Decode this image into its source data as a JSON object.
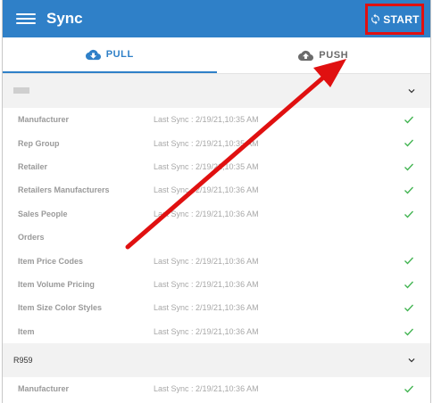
{
  "appbar": {
    "title": "Sync",
    "start_label": "START"
  },
  "tabs": [
    {
      "label": "PULL",
      "active": true
    },
    {
      "label": "PUSH",
      "active": false
    }
  ],
  "groups": [
    {
      "name": "",
      "rows": [
        {
          "name": "Manufacturer",
          "sync": "Last Sync : 2/19/21,10:35 AM",
          "done": true
        },
        {
          "name": "Rep Group",
          "sync": "Last Sync : 2/19/21,10:35 AM",
          "done": true
        },
        {
          "name": "Retailer",
          "sync": "Last Sync : 2/19/21,10:35 AM",
          "done": true
        },
        {
          "name": "Retailers Manufacturers",
          "sync": "Last Sync : 2/19/21,10:36 AM",
          "done": true
        },
        {
          "name": "Sales People",
          "sync": "Last Sync : 2/19/21,10:36 AM",
          "done": true
        },
        {
          "name": "Orders",
          "sync": "",
          "done": false
        },
        {
          "name": "Item Price Codes",
          "sync": "Last Sync : 2/19/21,10:36 AM",
          "done": true
        },
        {
          "name": "Item Volume Pricing",
          "sync": "Last Sync : 2/19/21,10:36 AM",
          "done": true
        },
        {
          "name": "Item Size Color Styles",
          "sync": "Last Sync : 2/19/21,10:36 AM",
          "done": true
        },
        {
          "name": "Item",
          "sync": "Last Sync : 2/19/21,10:36 AM",
          "done": true
        }
      ]
    },
    {
      "name": "R959",
      "rows": [
        {
          "name": "Manufacturer",
          "sync": "Last Sync : 2/19/21,10:36 AM",
          "done": true
        }
      ]
    }
  ],
  "colors": {
    "primary": "#2f80c8",
    "check": "#3fb34f",
    "highlight": "#e01010"
  },
  "icons": {
    "menu": "hamburger-icon",
    "sync": "sync-icon",
    "pull": "cloud-download-icon",
    "push": "cloud-upload-icon",
    "expand": "chevron-down-icon",
    "done": "check-icon"
  }
}
